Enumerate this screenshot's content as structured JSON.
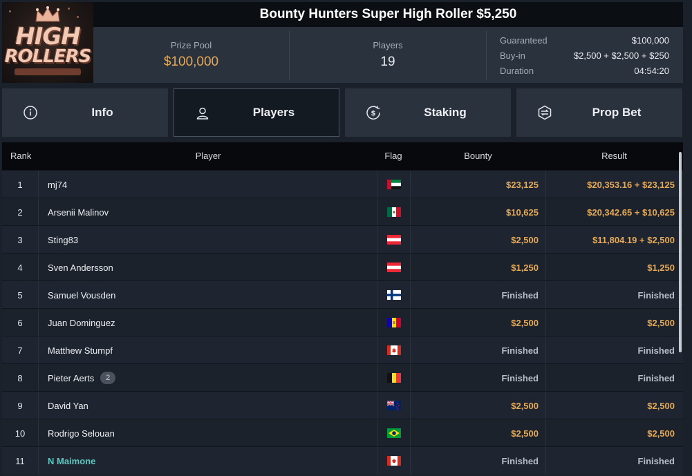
{
  "header": {
    "logo_line1": "HIGH",
    "logo_line2": "ROLLERS",
    "title": "Bounty Hunters Super High Roller $5,250",
    "prize_pool_label": "Prize Pool",
    "prize_pool_value": "$100,000",
    "players_label": "Players",
    "players_value": "19",
    "details": [
      {
        "key": "Guaranteed",
        "value": "$100,000"
      },
      {
        "key": "Buy-in",
        "value": "$2,500 + $2,500 + $250"
      },
      {
        "key": "Duration",
        "value": "04:54:20"
      }
    ]
  },
  "tabs": [
    {
      "label": "Info",
      "icon": "info-icon",
      "active": false
    },
    {
      "label": "Players",
      "icon": "user-icon",
      "active": true
    },
    {
      "label": "Staking",
      "icon": "dollar-coin-icon",
      "active": false
    },
    {
      "label": "Prop Bet",
      "icon": "prop-bet-icon",
      "active": false
    }
  ],
  "table": {
    "headers": {
      "rank": "Rank",
      "player": "Player",
      "flag": "Flag",
      "bounty": "Bounty",
      "result": "Result"
    },
    "rows": [
      {
        "rank": "1",
        "player": "mj74",
        "flag": "uae",
        "bounty": "$23,125",
        "result": "$20,353.16 + $23,125"
      },
      {
        "rank": "2",
        "player": "Arsenii Malinov",
        "flag": "mexico",
        "bounty": "$10,625",
        "result": "$20,342.65 + $10,625"
      },
      {
        "rank": "3",
        "player": "Sting83",
        "flag": "austria",
        "bounty": "$2,500",
        "result": "$11,804.19 + $2,500"
      },
      {
        "rank": "4",
        "player": "Sven Andersson",
        "flag": "austria",
        "bounty": "$1,250",
        "result": "$1,250"
      },
      {
        "rank": "5",
        "player": "Samuel Vousden",
        "flag": "finland",
        "bounty": "Finished",
        "result": "Finished"
      },
      {
        "rank": "6",
        "player": "Juan Dominguez",
        "flag": "andorra",
        "bounty": "$2,500",
        "result": "$2,500"
      },
      {
        "rank": "7",
        "player": "Matthew Stumpf",
        "flag": "canada",
        "bounty": "Finished",
        "result": "Finished"
      },
      {
        "rank": "8",
        "player": "Pieter Aerts",
        "badge": "2",
        "flag": "belgium",
        "bounty": "Finished",
        "result": "Finished"
      },
      {
        "rank": "9",
        "player": "David Yan",
        "flag": "new-zealand",
        "bounty": "$2,500",
        "result": "$2,500"
      },
      {
        "rank": "10",
        "player": "Rodrigo Selouan",
        "flag": "brazil",
        "bounty": "$2,500",
        "result": "$2,500"
      },
      {
        "rank": "11",
        "player": "N Maimone",
        "flag": "canada",
        "bounty": "Finished",
        "result": "Finished",
        "link": true
      }
    ]
  },
  "colors": {
    "accent_gold": "#e6a957",
    "link_teal": "#5ec8c0",
    "panel": "#2a323d",
    "title_bar": "#0b0e12"
  }
}
